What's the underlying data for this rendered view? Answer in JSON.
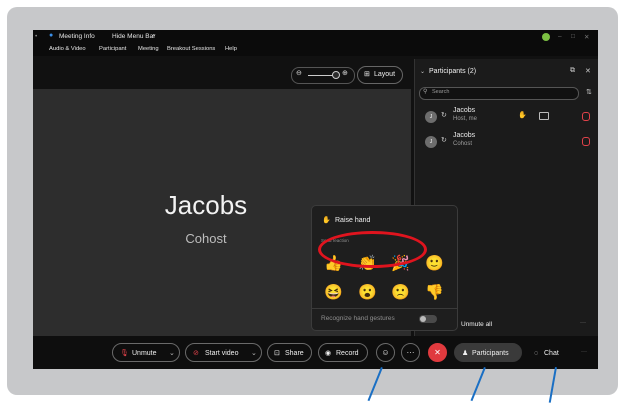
{
  "menubar": {
    "meeting_info": "Meeting Info",
    "hide_menu_bar": "Hide Menu Bar",
    "menus": [
      "Audio & Video",
      "Participant",
      "Meeting",
      "Breakout Sessions",
      "Help"
    ]
  },
  "stage": {
    "layout_label": "Layout",
    "name": "Jacobs",
    "role": "Cohost"
  },
  "participants": {
    "title": "Participants (2)",
    "search_placeholder": "Search",
    "list": [
      {
        "name": "Jacobs",
        "sub": "Host, me"
      },
      {
        "name": "Jacobs",
        "sub": "Cohost"
      }
    ],
    "unmute_all": "Unmute all"
  },
  "reactions": {
    "raise_hand": "Raise hand",
    "send_reaction": "Send reaction",
    "emojis": [
      "👍",
      "👏",
      "🎉",
      "🙂",
      "😆",
      "😮",
      "🙁",
      "👎"
    ],
    "gestures_label": "Recognize hand gestures"
  },
  "toolbar": {
    "unmute": "Unmute",
    "start_video": "Start video",
    "share": "Share",
    "record": "Record",
    "more": "···",
    "participants": "Participants",
    "chat": "Chat",
    "end": "✕"
  },
  "colors": {
    "annotation_red": "#e0141e",
    "end_button": "#e03a3e",
    "pointer_blue": "#1a6fc4"
  }
}
